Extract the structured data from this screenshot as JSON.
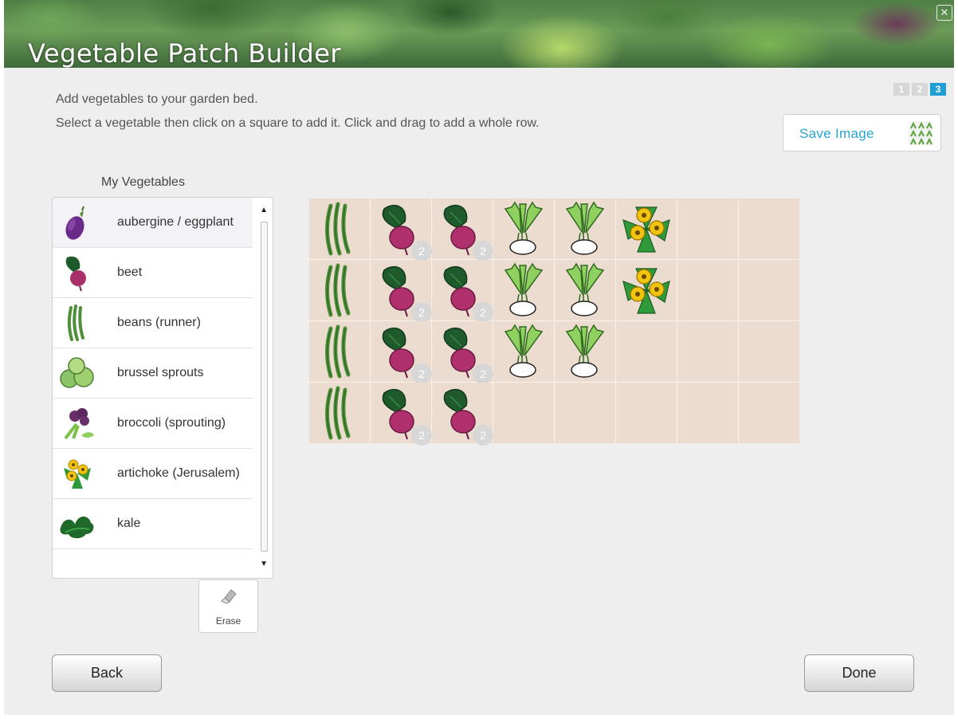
{
  "header": {
    "title": "Vegetable Patch Builder",
    "close_icon": "close-icon"
  },
  "steps": [
    {
      "label": "1",
      "active": false
    },
    {
      "label": "2",
      "active": false
    },
    {
      "label": "3",
      "active": true
    }
  ],
  "instructions": {
    "line1": "Add vegetables to your garden bed.",
    "line2": "Select a vegetable then click on a square to add it. Click and drag to add a whole row."
  },
  "save": {
    "label": "Save Image",
    "icon": "grid-image-icon"
  },
  "vegetables": {
    "title": "My Vegetables",
    "items": [
      {
        "label": "aubergine / eggplant",
        "icon": "aubergine-icon",
        "selected": true
      },
      {
        "label": "beet",
        "icon": "beet-icon",
        "selected": false
      },
      {
        "label": "beans (runner)",
        "icon": "beans-icon",
        "selected": false
      },
      {
        "label": "brussel sprouts",
        "icon": "brussel-sprouts-icon",
        "selected": false
      },
      {
        "label": "broccoli (sprouting)",
        "icon": "broccoli-icon",
        "selected": false
      },
      {
        "label": "artichoke (Jerusalem)",
        "icon": "artichoke-icon",
        "selected": false
      },
      {
        "label": "kale",
        "icon": "kale-icon",
        "selected": false
      }
    ]
  },
  "erase": {
    "label": "Erase",
    "icon": "eraser-icon"
  },
  "garden": {
    "rows": 4,
    "cols": 8,
    "cells": [
      [
        {
          "veg": "beans"
        },
        {
          "veg": "beet",
          "count": "2"
        },
        {
          "veg": "beet",
          "count": "2"
        },
        {
          "veg": "celeriac"
        },
        {
          "veg": "celeriac"
        },
        {
          "veg": "artichoke"
        },
        null,
        null
      ],
      [
        {
          "veg": "beans"
        },
        {
          "veg": "beet",
          "count": "2"
        },
        {
          "veg": "beet",
          "count": "2"
        },
        {
          "veg": "celeriac"
        },
        {
          "veg": "celeriac"
        },
        {
          "veg": "artichoke"
        },
        null,
        null
      ],
      [
        {
          "veg": "beans"
        },
        {
          "veg": "beet",
          "count": "2"
        },
        {
          "veg": "beet",
          "count": "2"
        },
        {
          "veg": "celeriac"
        },
        {
          "veg": "celeriac"
        },
        null,
        null,
        null
      ],
      [
        {
          "veg": "beans"
        },
        {
          "veg": "beet",
          "count": "2"
        },
        {
          "veg": "beet",
          "count": "2"
        },
        null,
        null,
        null,
        null,
        null
      ]
    ]
  },
  "nav": {
    "back_label": "Back",
    "done_label": "Done"
  },
  "colors": {
    "accent": "#1f9fd6",
    "soil": "#ecdccf",
    "background": "#eeeeee"
  }
}
